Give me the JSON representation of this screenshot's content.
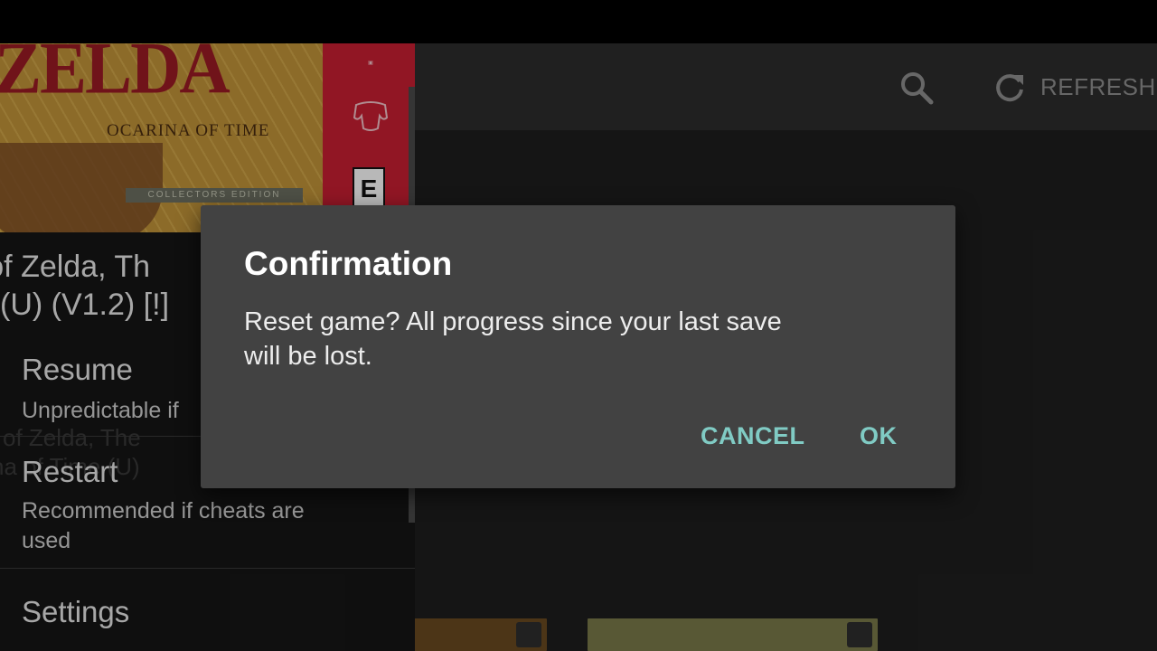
{
  "toolbar": {
    "search_icon": "search-icon",
    "refresh_icon": "refresh-icon",
    "refresh_label": "REFRESH"
  },
  "drawer": {
    "cover": {
      "title": "ZELDA",
      "subtitle": "OCARINA OF TIME",
      "edition": "COLLECTORS EDITION",
      "rating": "E"
    },
    "game_title_line1": "nd of Zelda, Th",
    "game_title_line2": "(U) (V1.2) [!]",
    "items": [
      {
        "label": "Resume",
        "description": "Unpredictable if"
      },
      {
        "label": "Restart",
        "description": "Recommended if cheats are used"
      },
      {
        "label": "Settings"
      }
    ]
  },
  "dialog": {
    "title": "Confirmation",
    "message": "Reset game? All progress since your last save will be lost.",
    "cancel_label": "CANCEL",
    "ok_label": "OK"
  },
  "colors": {
    "dialog_bg": "#424242",
    "accent": "#80cbc4",
    "drawer_bg": "#161616",
    "toolbar_bg": "#2d2d2d"
  }
}
